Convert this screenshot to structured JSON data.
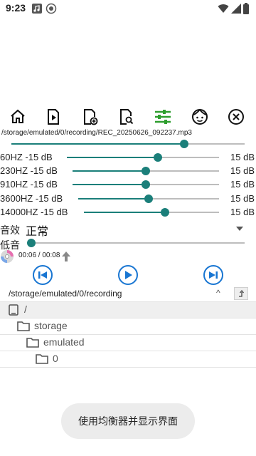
{
  "status_bar": {
    "time": "9:23"
  },
  "toolbar": {
    "items": [
      {
        "name": "home-icon"
      },
      {
        "name": "play-file-icon"
      },
      {
        "name": "add-file-icon"
      },
      {
        "name": "search-file-icon"
      },
      {
        "name": "equalizer-icon"
      },
      {
        "name": "face-icon"
      },
      {
        "name": "close-icon"
      }
    ],
    "accent": "#2e9e2e"
  },
  "current_file": "/storage/emulated/0/recording/REC_20250626_092237.mp3",
  "progress_fraction": 0.74,
  "equalizer": {
    "bands": [
      {
        "label": "60HZ -15 dB",
        "max": "15 dB",
        "level": 0.6
      },
      {
        "label": "230HZ -15 dB",
        "max": "15 dB",
        "level": 0.5
      },
      {
        "label": "910HZ -15 dB",
        "max": "15 dB",
        "level": 0.5
      },
      {
        "label": "3600HZ -15 dB",
        "max": "15 dB",
        "level": 0.5
      },
      {
        "label": "14000HZ -15 dB",
        "max": "15 dB",
        "level": 0.6
      }
    ]
  },
  "effect": {
    "label": "音效",
    "value": "正常"
  },
  "bass": {
    "label": "低音",
    "level": 0.0
  },
  "playback": {
    "time": "00:06 / 00:08"
  },
  "browser": {
    "path": "/storage/emulated/0/recording",
    "entries": [
      {
        "name": "/",
        "icon": "device-icon"
      },
      {
        "name": "storage",
        "icon": "folder-icon"
      },
      {
        "name": "emulated",
        "icon": "folder-icon"
      },
      {
        "name": "0",
        "icon": "folder-icon"
      }
    ]
  },
  "toast": "使用均衡器并显示界面",
  "colors": {
    "teal": "#1b7f7a",
    "blue": "#1976d2"
  }
}
